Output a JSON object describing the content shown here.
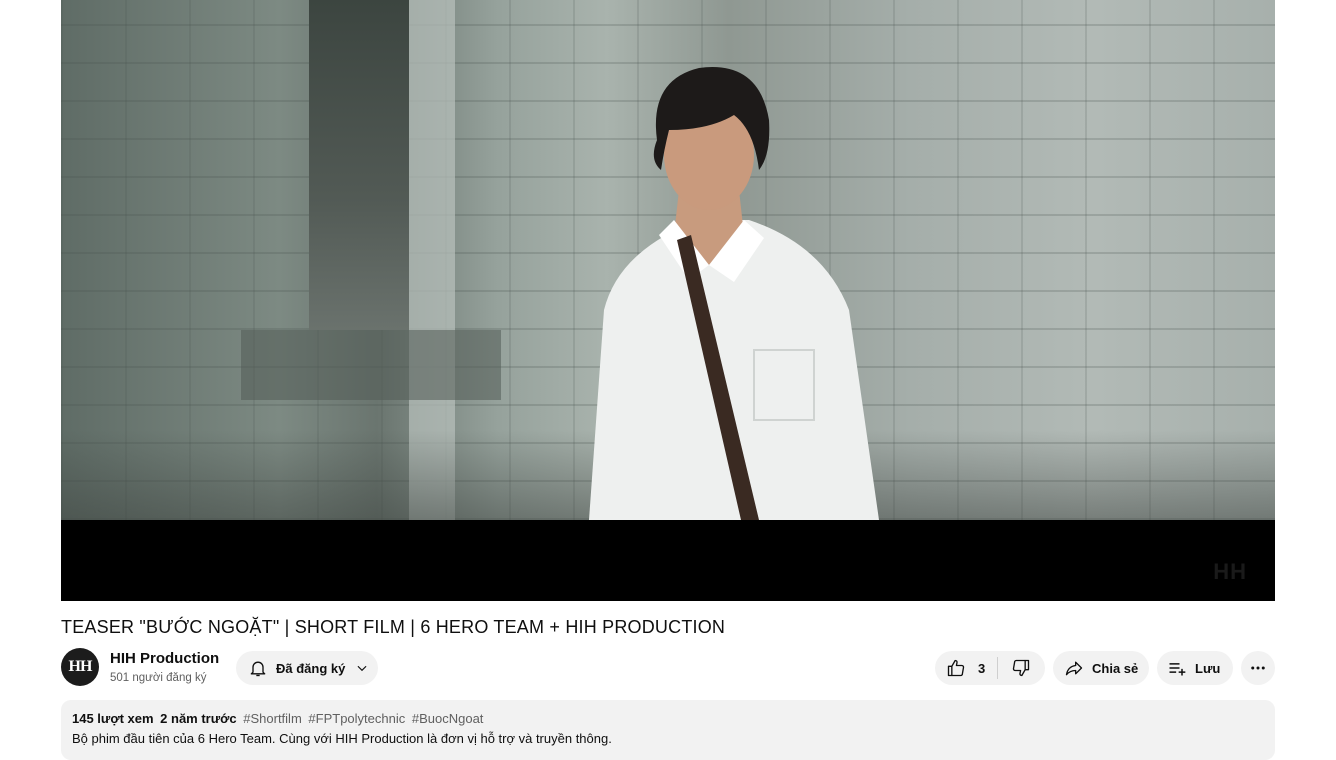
{
  "video": {
    "watermark": "HH"
  },
  "title": "TEASER \"BƯỚC NGOẶT\" | SHORT FILM | 6 HERO TEAM + HIH PRODUCTION",
  "channel": {
    "avatar_text": "HH",
    "name": "HIH Production",
    "subscribers": "501 người đăng ký",
    "subscribe_label": "Đã đăng ký"
  },
  "actions": {
    "like_count": "3",
    "share_label": "Chia sẻ",
    "save_label": "Lưu"
  },
  "description": {
    "views": "145 lượt xem",
    "age": "2 năm trước",
    "hashtags": [
      "#Shortfilm",
      "#FPTpolytechnic",
      "#BuocNgoat"
    ],
    "text": "Bộ phim đầu tiên của 6 Hero Team. Cùng với HIH Production là đơn vị hỗ trợ và truyền thông."
  },
  "icons": [
    "bell-icon",
    "chevron-down-icon",
    "thumbs-up-icon",
    "thumbs-down-icon",
    "share-icon",
    "playlist-add-icon",
    "more-icon"
  ]
}
